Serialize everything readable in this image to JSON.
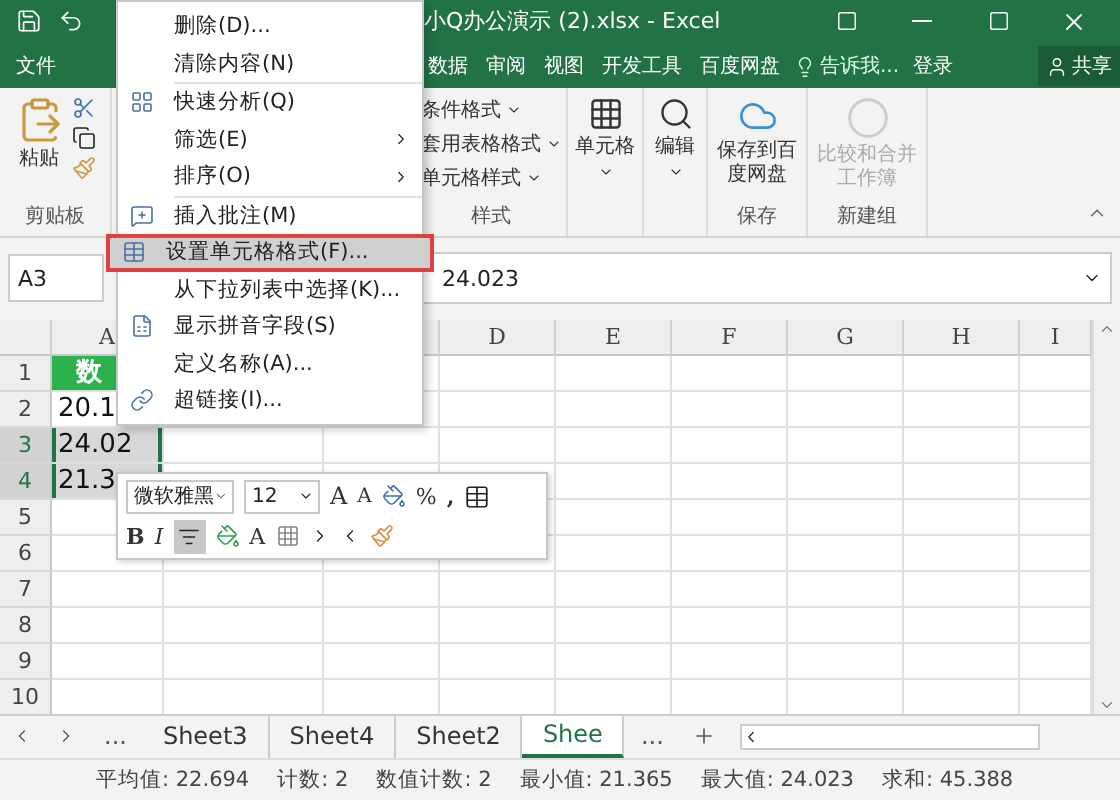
{
  "window": {
    "title": "小Q办公演示 (2).xlsx - Excel"
  },
  "ribbon_tabs": [
    {
      "label": "文件",
      "selected": false
    },
    {
      "label": "数据",
      "selected": false
    },
    {
      "label": "审阅",
      "selected": false
    },
    {
      "label": "视图",
      "selected": false
    },
    {
      "label": "开发工具",
      "selected": false
    },
    {
      "label": "百度网盘",
      "selected": false
    }
  ],
  "tell_me": {
    "placeholder": "告诉我..."
  },
  "sign_in": "登录",
  "share": "共享",
  "ribbon": {
    "clipboard": {
      "paste": "粘贴",
      "label": "剪贴板"
    },
    "styles": {
      "items": [
        "条件格式",
        "套用表格格式",
        "单元格样式"
      ],
      "label": "样式"
    },
    "cells": "单元格",
    "editing": "编辑",
    "save": {
      "button": "保存到百度网盘",
      "label": "保存"
    },
    "new_group": {
      "button": "比较和合并工作簿",
      "label": "新建组",
      "disabled": true
    }
  },
  "formula_bar": {
    "name_box": "A3",
    "value": "24.023"
  },
  "column_headers": [
    "A",
    "D",
    "E",
    "F",
    "G",
    "H",
    "I"
  ],
  "rows": [
    {
      "header": "1",
      "selected": false,
      "cells": [
        {
          "kind": "header",
          "text": "数"
        }
      ]
    },
    {
      "header": "2",
      "selected": false,
      "cells": [
        {
          "kind": "value",
          "text": "20.1"
        }
      ]
    },
    {
      "header": "3",
      "selected": true,
      "cells": [
        {
          "kind": "value",
          "text": "24.02"
        }
      ]
    },
    {
      "header": "4",
      "selected": true,
      "cells": [
        {
          "kind": "value",
          "text": "21.3"
        }
      ]
    },
    {
      "header": "5",
      "selected": false,
      "cells": []
    },
    {
      "header": "6",
      "selected": false,
      "cells": []
    },
    {
      "header": "7",
      "selected": false,
      "cells": []
    },
    {
      "header": "8",
      "selected": false,
      "cells": []
    },
    {
      "header": "9",
      "selected": false,
      "cells": []
    },
    {
      "header": "10",
      "selected": false,
      "cells": []
    }
  ],
  "context_menu": {
    "groups": [
      [
        {
          "label": "删除(D)...",
          "submenu": false,
          "highlighted": false
        },
        {
          "label": "清除内容(N)",
          "submenu": false,
          "highlighted": false
        }
      ],
      [
        {
          "label": "快速分析(Q)",
          "submenu": false,
          "highlighted": false
        },
        {
          "label": "筛选(E)",
          "submenu": true,
          "highlighted": false
        },
        {
          "label": "排序(O)",
          "submenu": true,
          "highlighted": false
        }
      ],
      [
        {
          "label": "插入批注(M)",
          "submenu": false,
          "highlighted": false
        },
        {
          "label": "设置单元格格式(F)...",
          "submenu": false,
          "highlighted": true
        },
        {
          "label": "从下拉列表中选择(K)...",
          "submenu": false,
          "highlighted": false
        },
        {
          "label": "显示拼音字段(S)",
          "submenu": false,
          "highlighted": false
        },
        {
          "label": "定义名称(A)...",
          "submenu": false,
          "highlighted": false
        },
        {
          "label": "超链接(I)...",
          "submenu": false,
          "highlighted": false
        }
      ]
    ]
  },
  "mini_toolbar": {
    "font": "微软雅黑",
    "size": "12",
    "grow_font": "A",
    "shrink_font": "A",
    "percent": "%",
    "comma": ",",
    "bold": "B",
    "italic": "I",
    "center_selected": true,
    "font_color": "A"
  },
  "sheet_tabs": [
    {
      "label": "Sheet3",
      "selected": false
    },
    {
      "label": "Sheet4",
      "selected": false
    },
    {
      "label": "Sheet2",
      "selected": false
    },
    {
      "label": "Shee",
      "selected": true
    }
  ],
  "sheet_more": "...",
  "sheet_more_right": "...",
  "status_bar": [
    "平均值: 22.694",
    "计数: 2",
    "数值计数: 2",
    "最小值: 21.365",
    "最大值: 24.023",
    "求和: 45.388"
  ]
}
